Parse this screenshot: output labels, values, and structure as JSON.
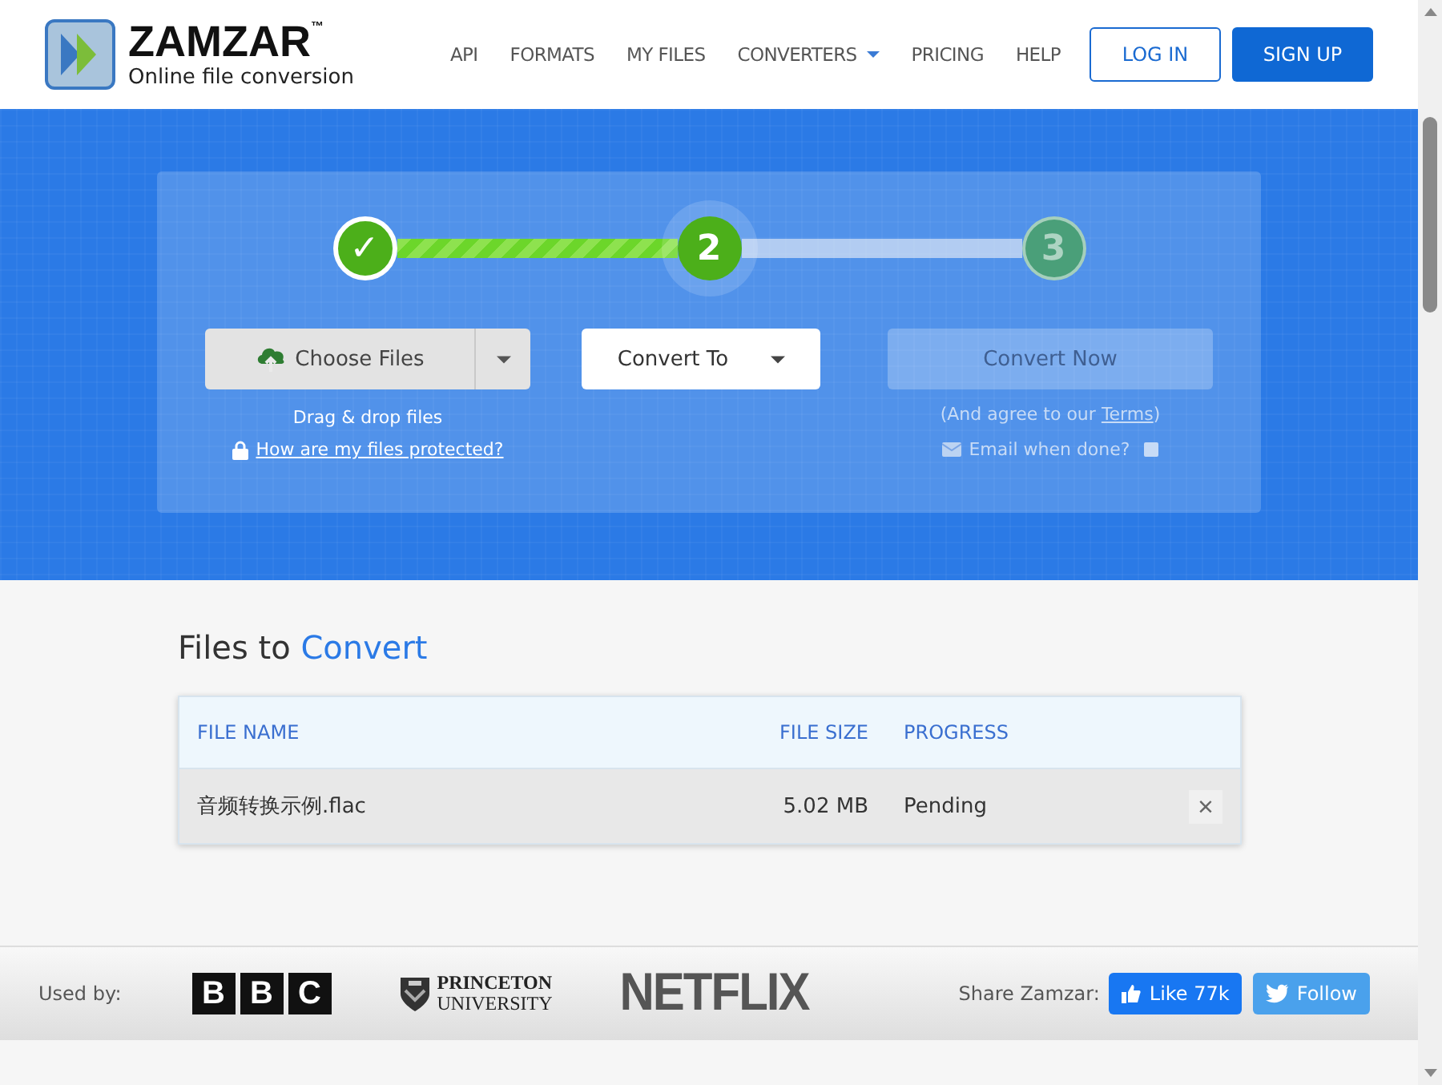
{
  "header": {
    "brand": "ZAMZAR",
    "trademark": "™",
    "tagline": "Online file conversion",
    "nav": [
      {
        "label": "API",
        "dropdown": false
      },
      {
        "label": "FORMATS",
        "dropdown": false
      },
      {
        "label": "MY FILES",
        "dropdown": false
      },
      {
        "label": "CONVERTERS",
        "dropdown": true
      },
      {
        "label": "PRICING",
        "dropdown": false
      },
      {
        "label": "HELP",
        "dropdown": false
      }
    ],
    "login": "LOG IN",
    "signup": "SIGN UP"
  },
  "steps": {
    "connectors": [
      {
        "complete": true
      },
      {
        "complete": false
      }
    ],
    "items": [
      {
        "kind": "done",
        "label": "✓"
      },
      {
        "kind": "current",
        "label": "2"
      },
      {
        "kind": "pending",
        "label": "3"
      }
    ]
  },
  "choose": {
    "button": "Choose Files",
    "hint": "Drag & drop files",
    "protected_link": "How are my files protected?"
  },
  "convert_to": {
    "button": "Convert To"
  },
  "convert_now": {
    "button": "Convert Now",
    "disabled": true,
    "agree": "(And agree to our ",
    "terms": "Terms",
    "agree_end": ")",
    "email": "Email when done?",
    "email_checked": false
  },
  "files": {
    "title": "Files to ",
    "title_accent": "Convert",
    "columns": [
      "FILE NAME",
      "FILE SIZE",
      "PROGRESS"
    ],
    "rows": [
      {
        "name": "音频转换示例.flac",
        "size": "5.02 MB",
        "progress": "Pending",
        "remove": "×"
      }
    ]
  },
  "footer": {
    "used_by": "Used by:",
    "logos": [
      {
        "kind": "bbc",
        "letters": [
          "B",
          "B",
          "C"
        ]
      },
      {
        "kind": "princeton",
        "lines": [
          "PRINCETON",
          "UNIVERSITY"
        ]
      },
      {
        "kind": "netflix",
        "text": "NETFLIX"
      }
    ],
    "share": "Share Zamzar:",
    "like": "Like 77k",
    "follow": "Follow"
  }
}
